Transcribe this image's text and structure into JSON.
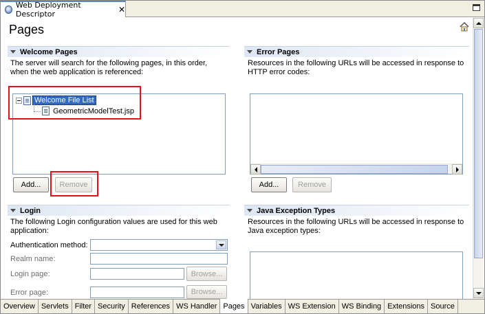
{
  "editor_tab": {
    "title": "Web Deployment Descriptor",
    "close_glyph": "✕"
  },
  "page": {
    "title": "Pages"
  },
  "welcome": {
    "header": "Welcome Pages",
    "description_line1": "The server will search for the following pages, in this order,",
    "description_line2": "when the web application is referenced:",
    "tree": {
      "root_label": "Welcome File List",
      "child_label": "GeometricModelTest.jsp"
    },
    "add_button": "Add...",
    "remove_button": "Remove"
  },
  "error_pages": {
    "header": "Error Pages",
    "description_line1": "Resources in the following URLs will be accessed in response to",
    "description_line2": "HTTP error codes:",
    "add_button": "Add...",
    "remove_button": "Remove"
  },
  "login": {
    "header": "Login",
    "description_line1": "The following Login configuration values are used for this web",
    "description_line2": "application:",
    "auth_label": "Authentication method:",
    "realm_label": "Realm name:",
    "login_page_label": "Login page:",
    "error_page_label": "Error page:",
    "browse_button": "Browse..."
  },
  "java_exceptions": {
    "header": "Java Exception Types",
    "description_line1": "Resources in the following URLs will be accessed in response to",
    "description_line2": "Java exception types:"
  },
  "bottom_tabs": [
    {
      "label": "Overview"
    },
    {
      "label": "Servlets"
    },
    {
      "label": "Filter"
    },
    {
      "label": "Security"
    },
    {
      "label": "References"
    },
    {
      "label": "WS Handler"
    },
    {
      "label": "Pages"
    },
    {
      "label": "Variables"
    },
    {
      "label": "WS Extension"
    },
    {
      "label": "WS Binding"
    },
    {
      "label": "Extensions"
    },
    {
      "label": "Source"
    }
  ],
  "active_tab": "Pages",
  "colors": {
    "highlight": "#e3101a",
    "selection": "#316ac5"
  }
}
